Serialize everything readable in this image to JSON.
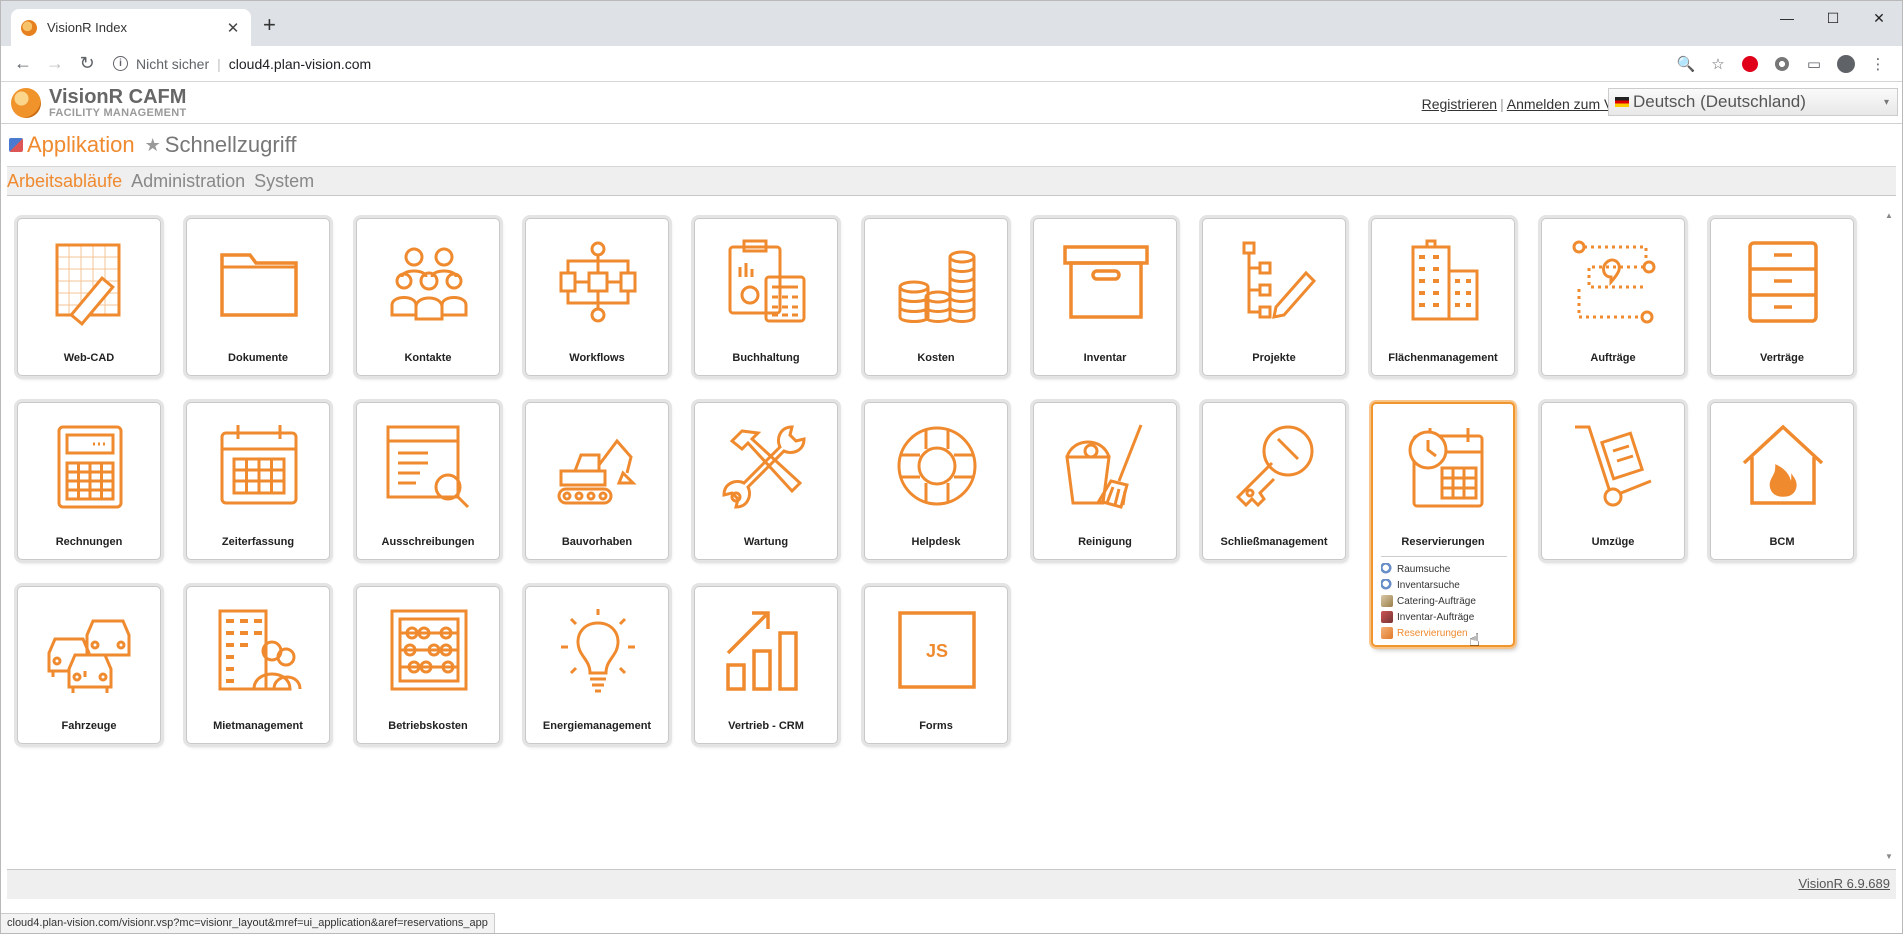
{
  "browser": {
    "tab_title": "VisionR Index",
    "tab_close": "✕",
    "new_tab": "+",
    "window_controls": [
      "—",
      "☐",
      "✕"
    ],
    "nav": {
      "back": "←",
      "forward": "→",
      "reload": "↻"
    },
    "address": {
      "info": "i",
      "security_label": "Nicht sicher",
      "separator": "|",
      "url": "cloud4.plan-vision.com"
    },
    "toolbar_icons": {
      "zoom": "🔍",
      "star": "☆",
      "cast": "▭",
      "menu": "⋮"
    }
  },
  "app": {
    "logo": {
      "name": "VisionR CAFM",
      "subtitle": "FACILITY MANAGEMENT"
    },
    "auth": {
      "register": "Registrieren",
      "separator": "|",
      "login": "Anmelden zum VisionR"
    },
    "language": {
      "selected": "Deutsch (Deutschland)",
      "dropdown": "▾"
    },
    "tabs": [
      {
        "label": "Applikation",
        "active": true
      },
      {
        "label": "Schnellzugriff",
        "active": false,
        "icon": "★"
      }
    ],
    "subnav": [
      "Arbeitsabläufe",
      "Administration",
      "System"
    ],
    "accent_color": "#ef8a2f",
    "tiles": [
      {
        "label": "Web-CAD",
        "icon": "cad-ruler-icon"
      },
      {
        "label": "Dokumente",
        "icon": "folder-icon"
      },
      {
        "label": "Kontakte",
        "icon": "people-icon"
      },
      {
        "label": "Workflows",
        "icon": "workflow-icon"
      },
      {
        "label": "Buchhaltung",
        "icon": "calculator-clipboard-icon"
      },
      {
        "label": "Kosten",
        "icon": "coins-icon"
      },
      {
        "label": "Inventar",
        "icon": "box-icon"
      },
      {
        "label": "Projekte",
        "icon": "project-tree-icon"
      },
      {
        "label": "Flächenmanagement",
        "icon": "buildings-icon"
      },
      {
        "label": "Aufträge",
        "icon": "route-pin-icon"
      },
      {
        "label": "Verträge",
        "icon": "cabinet-icon"
      },
      {
        "label": "Rechnungen",
        "icon": "calculator-icon"
      },
      {
        "label": "Zeiterfassung",
        "icon": "calendar-icon"
      },
      {
        "label": "Ausschreibungen",
        "icon": "document-search-icon"
      },
      {
        "label": "Bauvorhaben",
        "icon": "excavator-icon"
      },
      {
        "label": "Wartung",
        "icon": "tools-icon"
      },
      {
        "label": "Helpdesk",
        "icon": "lifebuoy-icon"
      },
      {
        "label": "Reinigung",
        "icon": "bucket-broom-icon"
      },
      {
        "label": "Schließmanagement",
        "icon": "key-icon"
      },
      {
        "label": "Reservierungen",
        "icon": "calendar-clock-icon",
        "selected": true
      },
      {
        "label": "Umzüge",
        "icon": "handtruck-icon"
      },
      {
        "label": "BCM",
        "icon": "house-fire-icon"
      },
      {
        "label": "Fahrzeuge",
        "icon": "cars-icon"
      },
      {
        "label": "Mietmanagement",
        "icon": "building-person-icon"
      },
      {
        "label": "Betriebskosten",
        "icon": "abacus-icon"
      },
      {
        "label": "Energiemanagement",
        "icon": "lightbulb-icon"
      },
      {
        "label": "Vertrieb - CRM",
        "icon": "growth-chart-icon"
      },
      {
        "label": "Forms",
        "icon": "js-file-icon"
      }
    ],
    "reservation_menu": [
      {
        "label": "Raumsuche",
        "icon": "search-icon"
      },
      {
        "label": "Inventarsuche",
        "icon": "search-icon"
      },
      {
        "label": "Catering-Aufträge",
        "icon": "catering-icon"
      },
      {
        "label": "Inventar-Aufträge",
        "icon": "inventory-icon"
      },
      {
        "label": "Reservierungen",
        "icon": "reservation-icon",
        "highlighted": true
      }
    ],
    "version": "VisionR 6.9.689",
    "status_url": "cloud4.plan-vision.com/visionr.vsp?mc=visionr_layout&mref=ui_application&aref=reservations_app"
  }
}
